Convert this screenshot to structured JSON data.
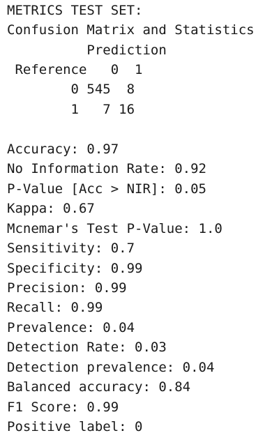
{
  "output": {
    "header": "METRICS TEST SET:",
    "cm_title": "Confusion Matrix and Statistics",
    "cm_prediction": "          Prediction",
    "cm_reference": " Reference   0  1",
    "cm_row0": "        0 545  8",
    "cm_row1": "        1   7 16",
    "stats": [
      "Accuracy: 0.97",
      "No Information Rate: 0.92",
      "P-Value [Acc > NIR]: 0.05",
      "Kappa: 0.67",
      "Mcnemar's Test P-Value: 1.0",
      "Sensitivity: 0.7",
      "Specificity: 0.99",
      "Precision: 0.99",
      "Recall: 0.99",
      "Prevalence: 0.04",
      "Detection Rate: 0.03",
      "Detection prevalence: 0.04",
      "Balanced accuracy: 0.84",
      "F1 Score: 0.99",
      "Positive label: 0"
    ]
  }
}
